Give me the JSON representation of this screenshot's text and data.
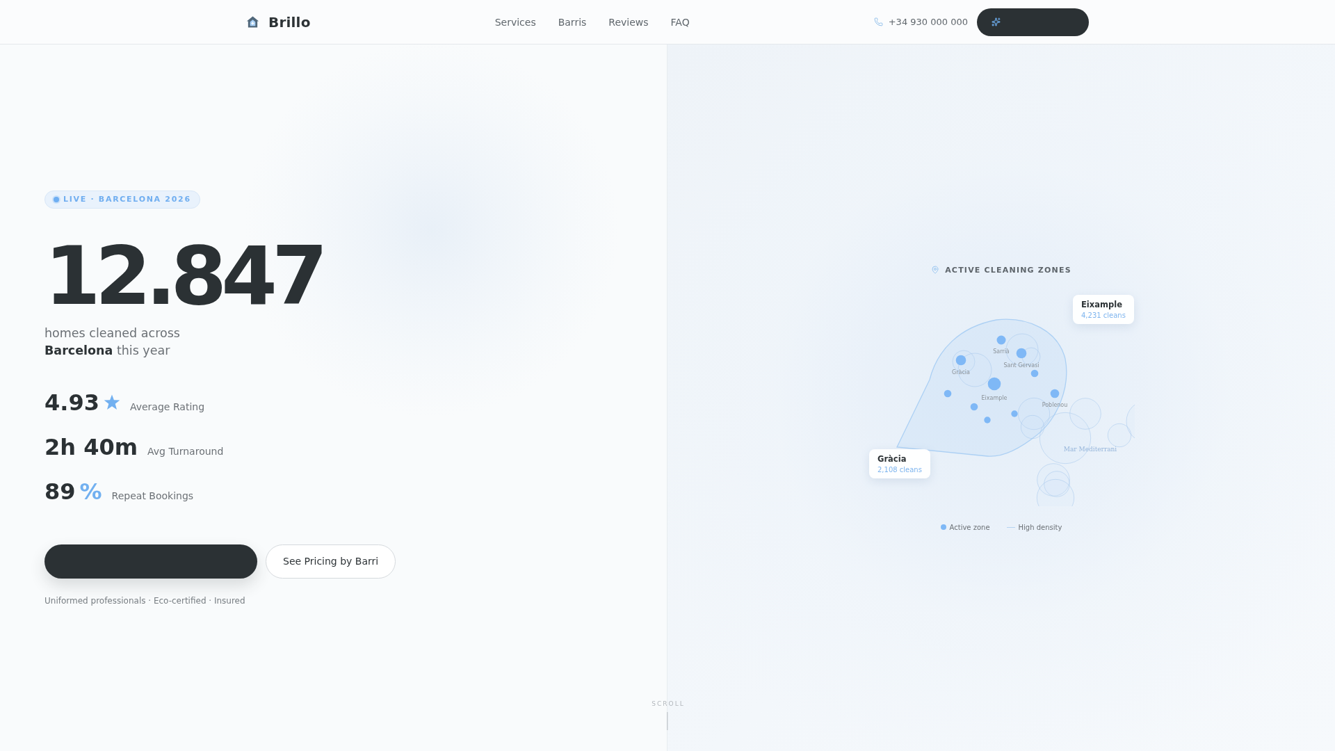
{
  "header": {
    "brand": "Brillo",
    "nav": [
      {
        "label": "Services"
      },
      {
        "label": "Barris"
      },
      {
        "label": "Reviews"
      },
      {
        "label": "FAQ"
      }
    ],
    "phone": "+34 930 000 000",
    "actions": [
      {
        "kind": "primary"
      }
    ]
  },
  "hero": {
    "badge": "LIVE · BARCELONA 2026",
    "count": "12.847",
    "caption": "homes cleaned across **Barcelona** this year",
    "stats": [
      {
        "kind": "rating",
        "value": "4.93",
        "label": "Average Rating"
      },
      {
        "kind": "plain",
        "value": "2h 40m",
        "label": "Avg Turnaround"
      },
      {
        "kind": "plain",
        "value": "89",
        "unit": "%",
        "label": "Repeat Bookings"
      }
    ],
    "actions": [
      {
        "kind": "primary"
      },
      {
        "kind": "secondary",
        "label": "See Pricing by Barri"
      }
    ],
    "footnote": "Uniformed professionals · Eco-certified · Insured"
  },
  "zones": {
    "title": "ACTIVE CLEANING ZONES",
    "map_labels": [
      {
        "kind": "district",
        "label": "Sarrià"
      },
      {
        "kind": "district",
        "label": "Gràcia"
      },
      {
        "kind": "district",
        "label": "Sant Gervasi"
      },
      {
        "kind": "district",
        "label": "Eixample"
      },
      {
        "kind": "district",
        "label": "Poblenou"
      },
      {
        "kind": "sea",
        "label": "Mar Mediterrani"
      }
    ],
    "callouts": [
      {
        "name": "Eixample",
        "count": "4,231 cleans"
      },
      {
        "name": "Gràcia",
        "count": "2,108 cleans"
      }
    ],
    "legend": [
      {
        "kind": "dot",
        "label": "Active zone"
      },
      {
        "kind": "line",
        "label": "High density"
      }
    ]
  },
  "scroll_hint": "SCROLL"
}
